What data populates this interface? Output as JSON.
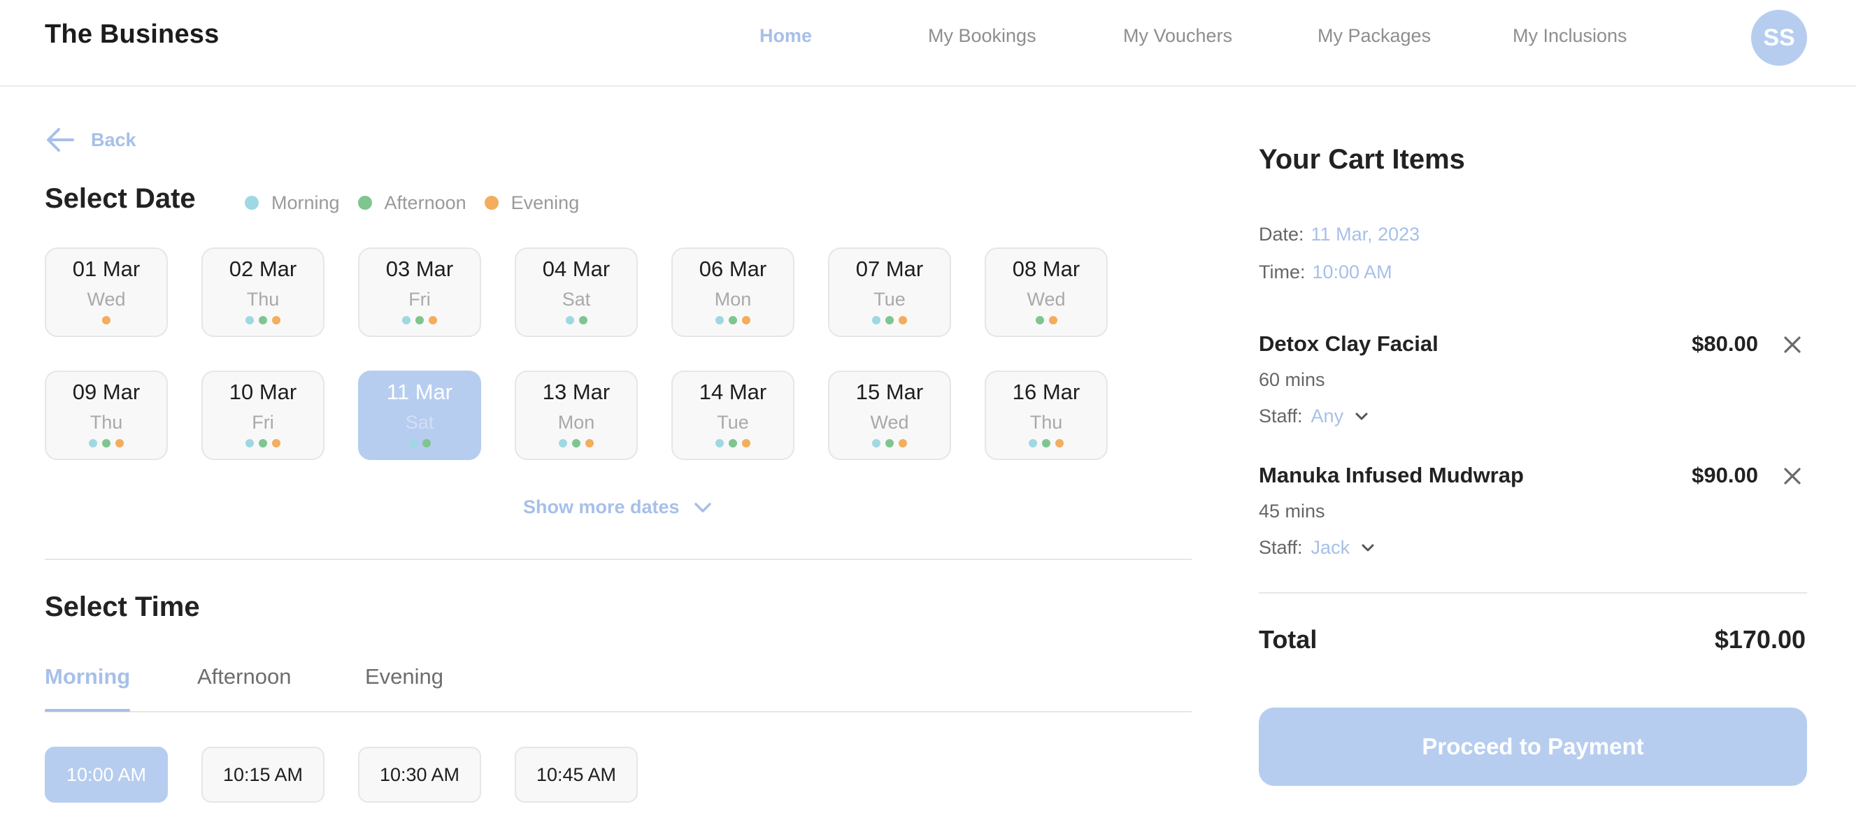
{
  "header": {
    "brand": "The Business",
    "nav": [
      {
        "label": "Home",
        "active": true
      },
      {
        "label": "My Bookings",
        "active": false
      },
      {
        "label": "My Vouchers",
        "active": false
      },
      {
        "label": "My Packages",
        "active": false
      },
      {
        "label": "My Inclusions",
        "active": false
      }
    ],
    "avatar_initials": "SS"
  },
  "back_label": "Back",
  "select_date": {
    "title": "Select Date",
    "legend": [
      {
        "label": "Morning",
        "color": "#9fd8e2"
      },
      {
        "label": "Afternoon",
        "color": "#7fc58f"
      },
      {
        "label": "Evening",
        "color": "#f3ad5c"
      }
    ],
    "dates": [
      {
        "date": "01 Mar",
        "day": "Wed",
        "slots": [
          "evening"
        ]
      },
      {
        "date": "02 Mar",
        "day": "Thu",
        "slots": [
          "morning",
          "afternoon",
          "evening"
        ]
      },
      {
        "date": "03 Mar",
        "day": "Fri",
        "slots": [
          "morning",
          "afternoon",
          "evening"
        ]
      },
      {
        "date": "04 Mar",
        "day": "Sat",
        "slots": [
          "morning",
          "afternoon"
        ]
      },
      {
        "date": "06 Mar",
        "day": "Mon",
        "slots": [
          "morning",
          "afternoon",
          "evening"
        ]
      },
      {
        "date": "07 Mar",
        "day": "Tue",
        "slots": [
          "morning",
          "afternoon",
          "evening"
        ]
      },
      {
        "date": "08 Mar",
        "day": "Wed",
        "slots": [
          "afternoon",
          "evening"
        ]
      },
      {
        "date": "09 Mar",
        "day": "Thu",
        "slots": [
          "morning",
          "afternoon",
          "evening"
        ]
      },
      {
        "date": "10 Mar",
        "day": "Fri",
        "slots": [
          "morning",
          "afternoon",
          "evening"
        ]
      },
      {
        "date": "11 Mar",
        "day": "Sat",
        "slots": [
          "morning",
          "afternoon"
        ],
        "selected": true
      },
      {
        "date": "13 Mar",
        "day": "Mon",
        "slots": [
          "morning",
          "afternoon",
          "evening"
        ]
      },
      {
        "date": "14 Mar",
        "day": "Tue",
        "slots": [
          "morning",
          "afternoon",
          "evening"
        ]
      },
      {
        "date": "15 Mar",
        "day": "Wed",
        "slots": [
          "morning",
          "afternoon",
          "evening"
        ]
      },
      {
        "date": "16 Mar",
        "day": "Thu",
        "slots": [
          "morning",
          "afternoon",
          "evening"
        ]
      }
    ],
    "show_more": "Show more dates"
  },
  "select_time": {
    "title": "Select Time",
    "tabs": [
      {
        "label": "Morning",
        "active": true
      },
      {
        "label": "Afternoon",
        "active": false
      },
      {
        "label": "Evening",
        "active": false
      }
    ],
    "slots": [
      {
        "label": "10:00 AM",
        "selected": true
      },
      {
        "label": "10:15 AM",
        "selected": false
      },
      {
        "label": "10:30 AM",
        "selected": false
      },
      {
        "label": "10:45 AM",
        "selected": false
      }
    ]
  },
  "cart": {
    "title": "Your Cart Items",
    "date_label": "Date:",
    "date_value": "11 Mar, 2023",
    "time_label": "Time:",
    "time_value": "10:00 AM",
    "items": [
      {
        "name": "Detox Clay Facial",
        "price": "$80.00",
        "duration": "60 mins",
        "staff_label": "Staff:",
        "staff": "Any"
      },
      {
        "name": "Manuka Infused Mudwrap",
        "price": "$90.00",
        "duration": "45 mins",
        "staff_label": "Staff:",
        "staff": "Jack"
      }
    ],
    "total_label": "Total",
    "total_value": "$170.00",
    "proceed_label": "Proceed to Payment"
  },
  "colors": {
    "accent": "#a7c0e8",
    "accent_fill": "#b6cdef",
    "morning": "#9fd8e2",
    "afternoon": "#7fc58f",
    "evening": "#f3ad5c"
  }
}
